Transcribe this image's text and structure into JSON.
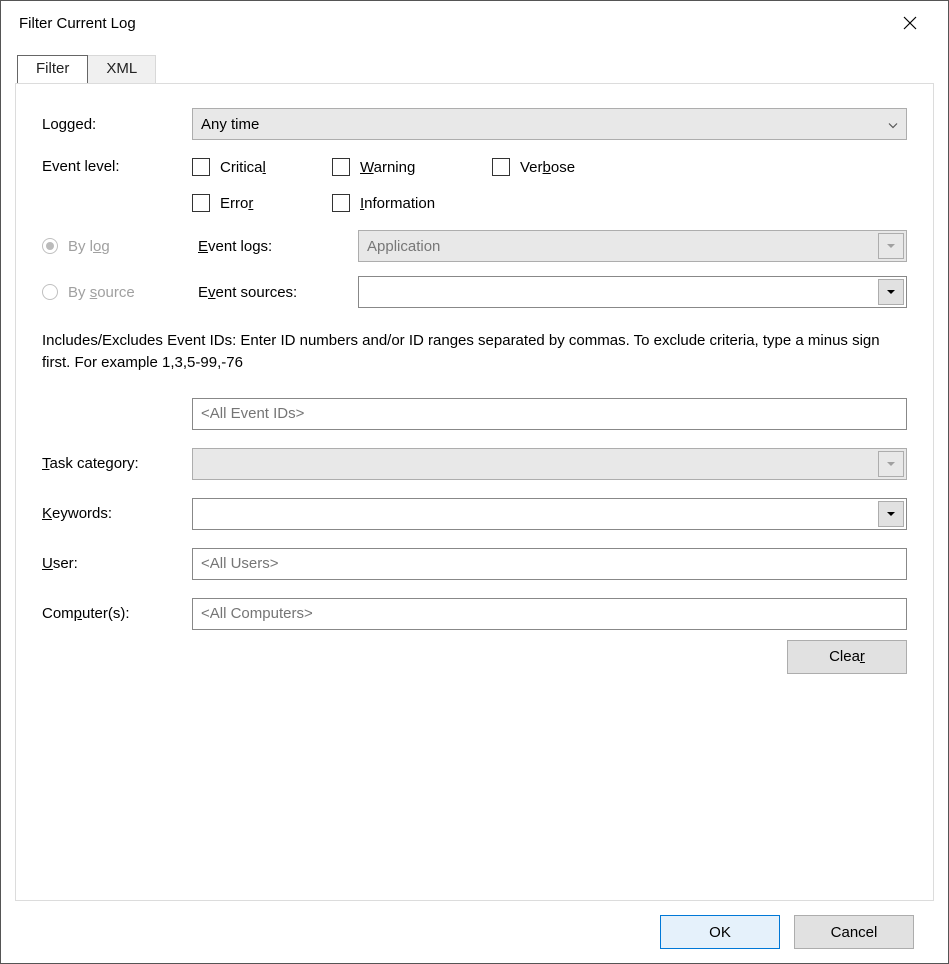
{
  "window": {
    "title": "Filter Current Log"
  },
  "tabs": {
    "filter": "Filter",
    "xml": "XML"
  },
  "labels": {
    "logged": "Logged:",
    "eventlevel": "Event level:",
    "bylog_pre": "By l",
    "bylog_u": "o",
    "bylog_post": "g",
    "bysource_pre": "By ",
    "bysource_u": "s",
    "bysource_post": "ource",
    "eventlogs_u": "E",
    "eventlogs_post": "vent logs:",
    "eventsources_pre": "E",
    "eventsources_u": "v",
    "eventsources_post": "ent sources:",
    "task_u": "T",
    "task_post": "ask category:",
    "keywords_u": "K",
    "keywords_post": "eywords:",
    "user_u": "U",
    "user_post": "ser:",
    "computers_pre": "Com",
    "computers_u": "p",
    "computers_post": "uter(s):"
  },
  "checks": {
    "critical_pre": "Critica",
    "critical_u": "l",
    "warning_u": "W",
    "warning_post": "arning",
    "verbose_pre": "Ver",
    "verbose_u": "b",
    "verbose_post": "ose",
    "error_pre": "Erro",
    "error_u": "r",
    "info_u": "I",
    "info_post": "nformation"
  },
  "values": {
    "logged": "Any time",
    "eventlogs": "Application",
    "eventsources": "",
    "eventids_placeholder": "<All Event IDs>",
    "taskcategory": "",
    "keywords": "",
    "user_placeholder": "<All Users>",
    "computers_placeholder": "<All Computers>"
  },
  "helptext": "Includes/Excludes Event IDs: Enter ID numbers and/or ID ranges separated by commas. To exclude criteria, type a minus sign first. For example 1,3,5-99,-76",
  "buttons": {
    "clear_pre": "Clea",
    "clear_u": "r",
    "ok": "OK",
    "cancel": "Cancel"
  }
}
